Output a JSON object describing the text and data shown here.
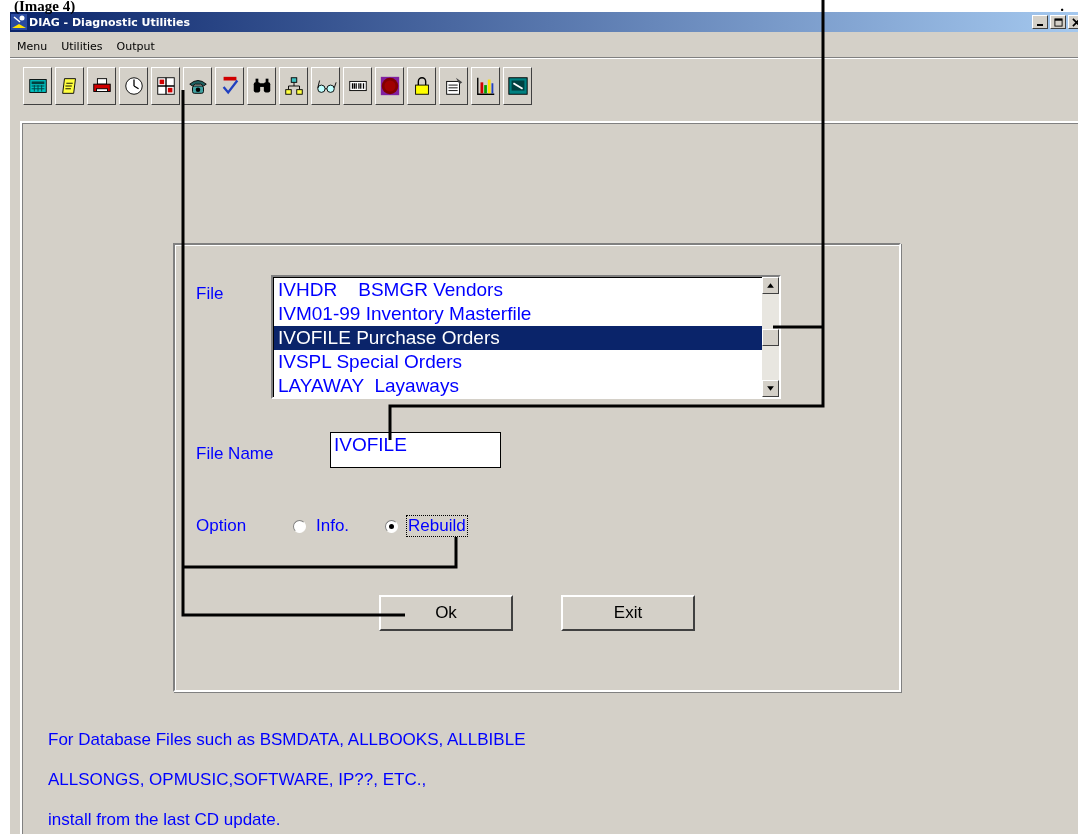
{
  "heading": {
    "text": "(Image 4)",
    "mark": "."
  },
  "window": {
    "title": "DIAG - Diagnostic Utilities"
  },
  "menu": [
    "Menu",
    "Utilities",
    "Output"
  ],
  "toolbar": [
    {
      "kind": "calculator"
    },
    {
      "kind": "notepad"
    },
    {
      "kind": "printer"
    },
    {
      "kind": "clock"
    },
    {
      "kind": "grid"
    },
    {
      "kind": "phone"
    },
    {
      "kind": "check"
    },
    {
      "kind": "binoculars"
    },
    {
      "kind": "network"
    },
    {
      "kind": "glasses"
    },
    {
      "kind": "barcode"
    },
    {
      "kind": "stop"
    },
    {
      "kind": "lock"
    },
    {
      "kind": "form"
    },
    {
      "kind": "chart"
    },
    {
      "kind": "monitor"
    }
  ],
  "form": {
    "file_label": "File",
    "files": [
      {
        "text": "IVHDR    BSMGR Vendors",
        "selected": false
      },
      {
        "text": "IVM01-99 Inventory Masterfile",
        "selected": false
      },
      {
        "text": "IVOFILE Purchase Orders",
        "selected": true
      },
      {
        "text": "IVSPL Special Orders",
        "selected": false
      },
      {
        "text": "LAYAWAY  Layaways",
        "selected": false
      }
    ],
    "file_name_label": "File Name",
    "file_name": "IVOFILE",
    "option_label": "Option",
    "options": [
      {
        "label": "Info.",
        "selected": false
      },
      {
        "label": "Rebuild",
        "selected": true
      }
    ],
    "buttons": [
      "Ok",
      "Exit"
    ]
  },
  "notes": [
    "For Database Files such as BSMDATA, ALLBOOKS, ALLBIBLE",
    "ALLSONGS, OPMUSIC,SOFTWARE, IP??, ETC.,",
    "install from the last CD update."
  ]
}
